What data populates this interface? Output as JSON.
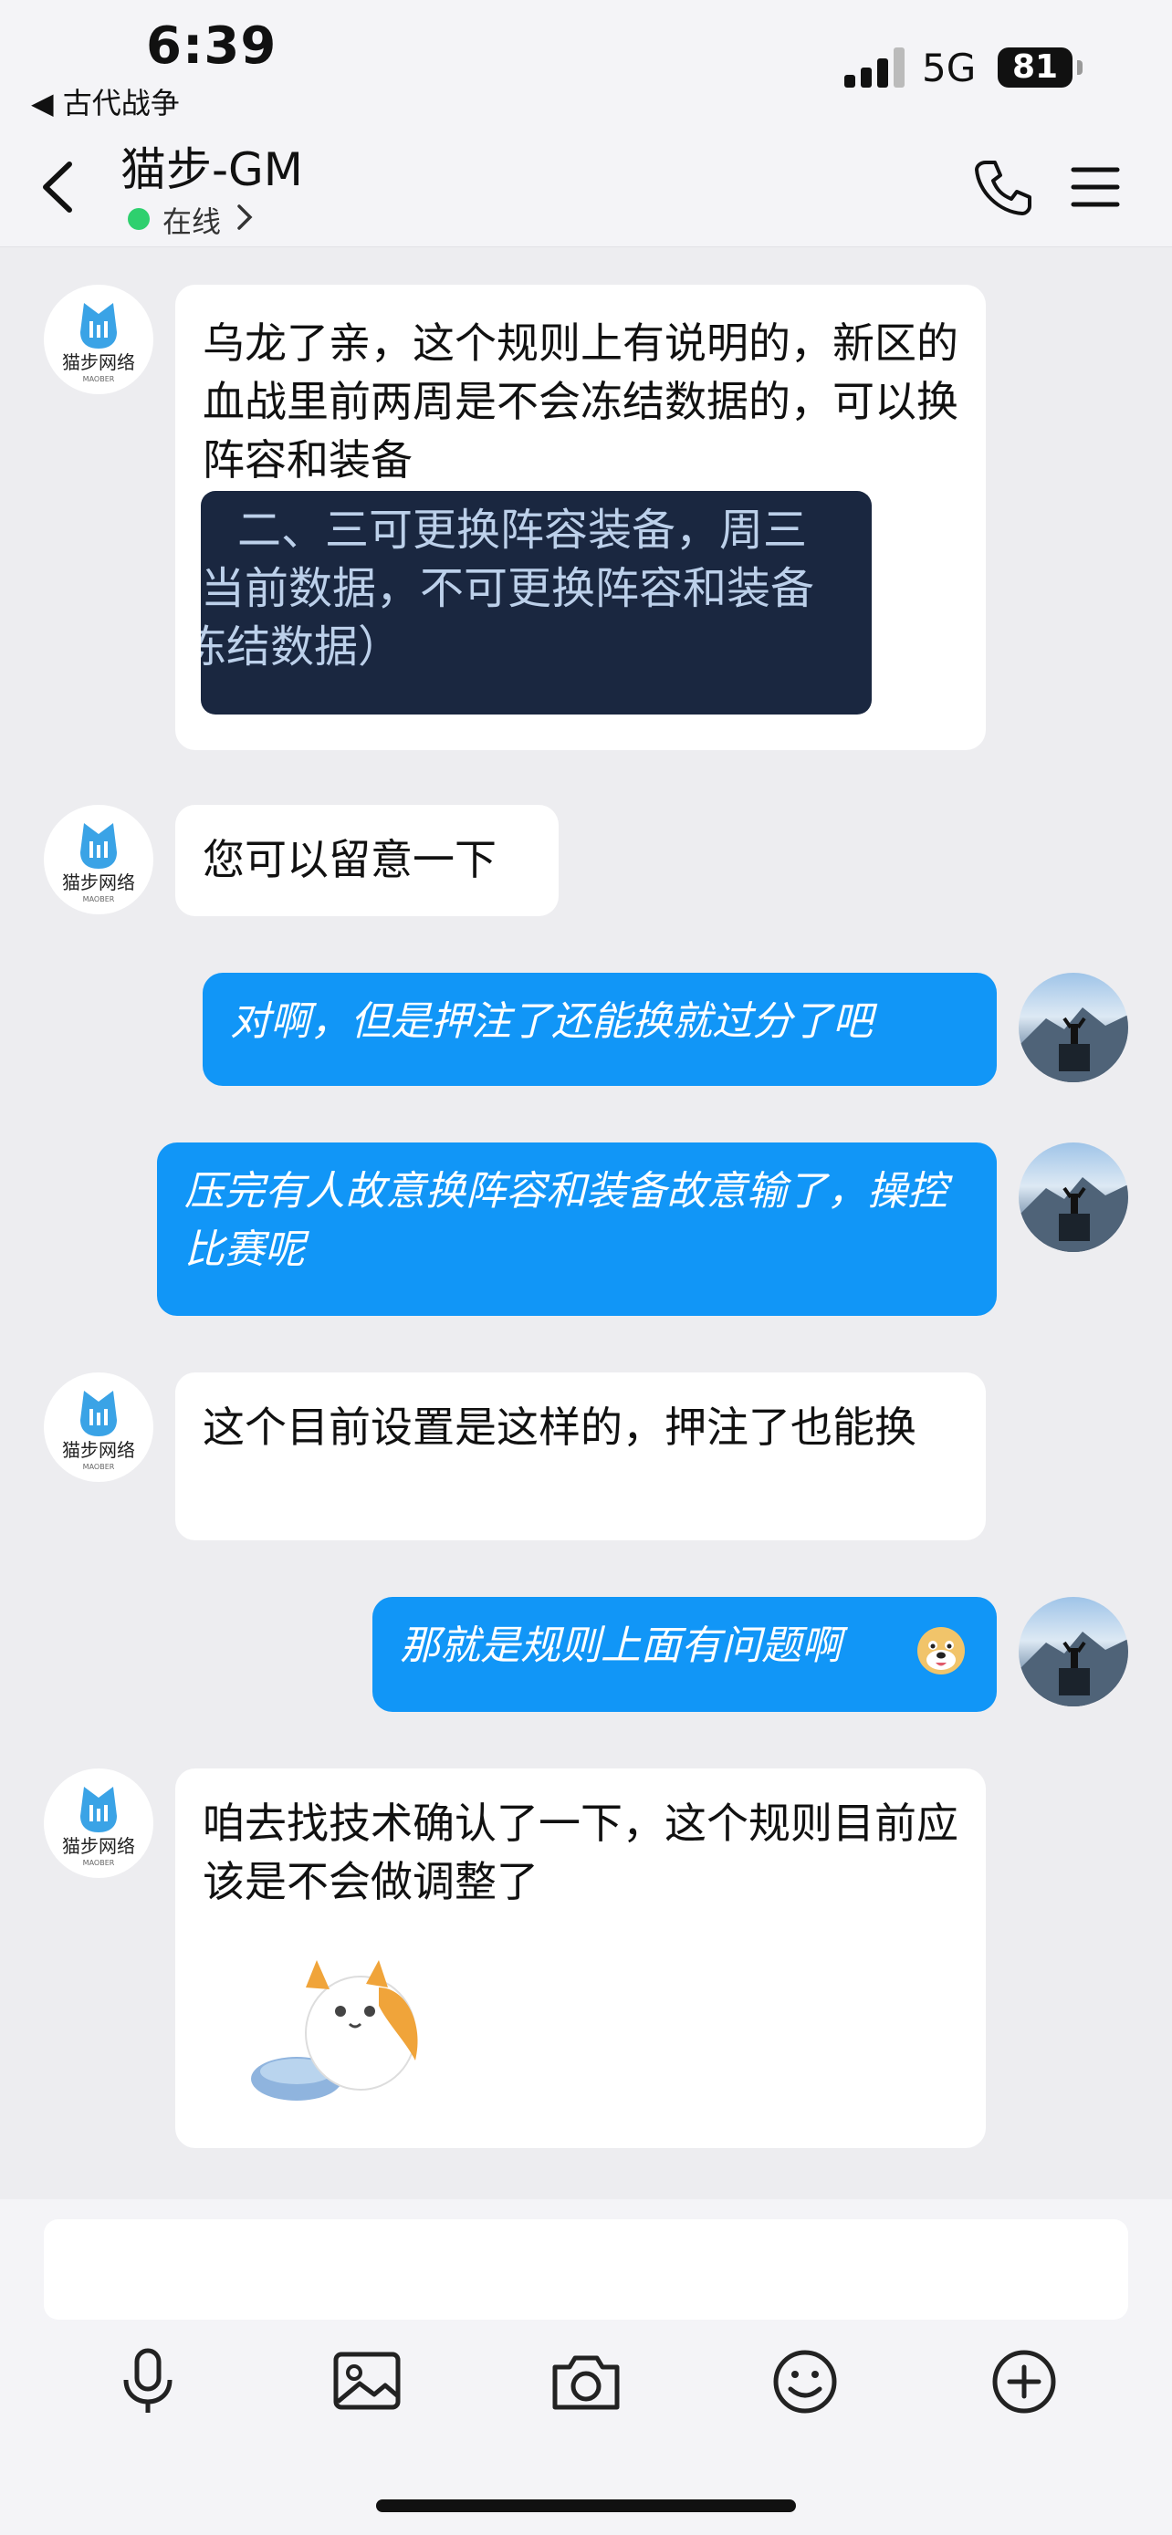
{
  "status": {
    "time": "6:39",
    "back_app": "◀ 古代战争",
    "network": "5G",
    "battery": "81"
  },
  "header": {
    "title": "猫步-GM",
    "presence": "在线"
  },
  "brand_avatar": {
    "name": "猫步网络",
    "sub": "MAOBER"
  },
  "messages": [
    {
      "text": "乌龙了亲，这个规则上有说明的，新区的血战里前两周是不会冻结数据的，可以换阵容和装备"
    },
    {
      "text": "您可以留意一下"
    },
    {
      "text": "对啊，但是押注了还能换就过分了吧"
    },
    {
      "text": "压完有人故意换阵容和装备故意输了，操控比赛呢"
    },
    {
      "text": "这个目前设置是这样的，押注了也能换"
    },
    {
      "text": "那就是规则上面有问题啊"
    },
    {
      "text": "咱去找技术确认了一下，这个规则目前应该是不会做调整了"
    }
  ],
  "quote_image": {
    "lines": [
      "二、三可更换阵容装备，周三",
      "当前数据，不可更换阵容和装备",
      "冻结数据）"
    ]
  },
  "colors": {
    "outgoing_bubble": "#1196f7",
    "incoming_bubble": "#ffffff",
    "background": "#ededf0",
    "online": "#2ed06e"
  },
  "toolbar_icons": [
    "microphone-icon",
    "image-icon",
    "camera-icon",
    "emoji-icon",
    "plus-icon"
  ]
}
